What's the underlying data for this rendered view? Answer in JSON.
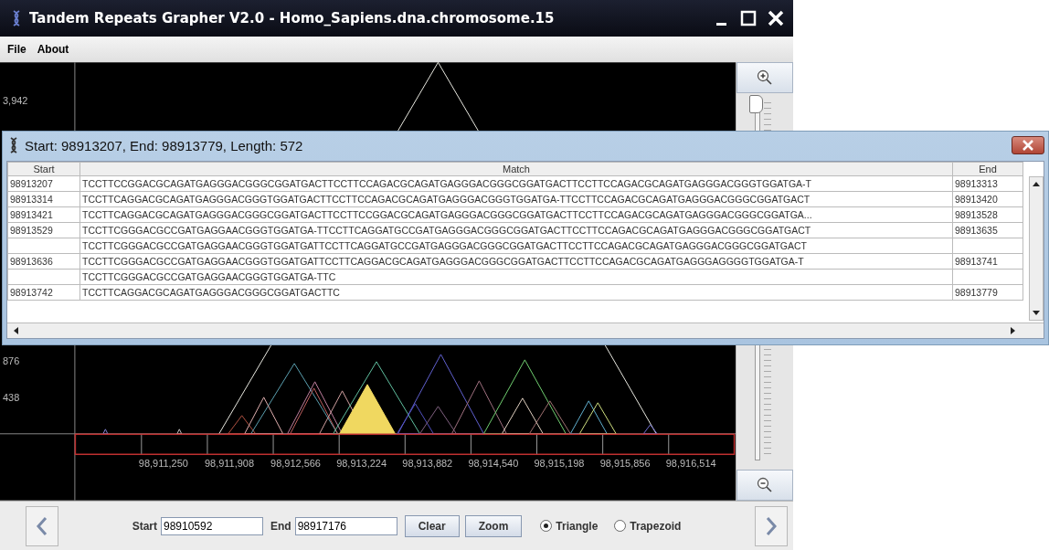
{
  "window": {
    "title": "Tandem Repeats Grapher V2.0 - Homo_Sapiens.dna.chromosome.15"
  },
  "menu": [
    "File",
    "About"
  ],
  "plot": {
    "y_labels": [
      "3,942",
      "876",
      "438"
    ],
    "x_labels": [
      "98,911,250",
      "98,911,908",
      "98,912,566",
      "98,913,224",
      "98,913,882",
      "98,914,540",
      "98,915,198",
      "98,915,856",
      "98,916,514"
    ]
  },
  "zoom_slider": {
    "level": 1
  },
  "dialog": {
    "title": "Start: 98913207, End: 98913779, Length: 572",
    "columns": [
      "Start",
      "Match",
      "End"
    ],
    "rows": [
      {
        "start": "98913207",
        "match": "TCCTTCCGGACGCAGATGAGGGACGGGCGGATGACTTCCTTCCAGACGCAGATGAGGGACGGGCGGATGACTTCCTTCCAGACGCAGATGAGGGACGGGTGGATGA-T",
        "end": "98913313"
      },
      {
        "start": "98913314",
        "match": "TCCTTCAGGACGCAGATGAGGGACGGGTGGATGACTTCCTTCCAGACGCAGATGAGGGACGGGTGGATGA-TTCCTTCCAGACGCAGATGAGGGACGGGCGGATGACT",
        "end": "98913420"
      },
      {
        "start": "98913421",
        "match": "TCCTTCAGGACGCAGATGAGGGACGGGCGGATGACTTCCTTCCGGACGCAGATGAGGGACGGGCGGATGACTTCCTTCCAGACGCAGATGAGGGACGGGCGGATGA...",
        "end": "98913528"
      },
      {
        "start": "98913529",
        "match": "TCCTTCGGGACGCCGATGAGGAACGGGTGGATGA-TTCCTTCAGGATGCCGATGAGGGACGGGCGGATGACTTCCTTCCAGACGCAGATGAGGGACGGGCGGATGACT",
        "end": "98913635"
      },
      {
        "match": "TCCTTCGGGACGCCGATGAGGAACGGGTGGATGATTCCTTCAGGATGCCGATGAGGGACGGGCGGATGACTTCCTTCCAGACGCAGATGAGGGACGGGCGGATGACT"
      },
      {
        "start": "98913636",
        "match": "TCCTTCGGGACGCCGATGAGGAACGGGTGGATGATTCCTTCAGGACGCAGATGAGGGACGGGCGGATGACTTCCTTCCAGACGCAGATGAGGGAGGGGTGGATGA-T",
        "end": "98913741"
      },
      {
        "match": "TCCTTCGGGACGCCGATGAGGAACGGGTGGATGA-TTC"
      },
      {
        "start": "98913742",
        "match": "TCCTTCAGGACGCAGATGAGGGACGGGCGGATGACTTC",
        "end": "98913779"
      }
    ]
  },
  "toolbar": {
    "start_label": "Start",
    "start_value": "98910592",
    "end_label": "End",
    "end_value": "98917176",
    "buttons": [
      "Clear",
      "Zoom"
    ],
    "shapes": [
      {
        "label": "Triangle",
        "selected": true
      },
      {
        "label": "Trapezoid",
        "selected": false
      }
    ]
  }
}
